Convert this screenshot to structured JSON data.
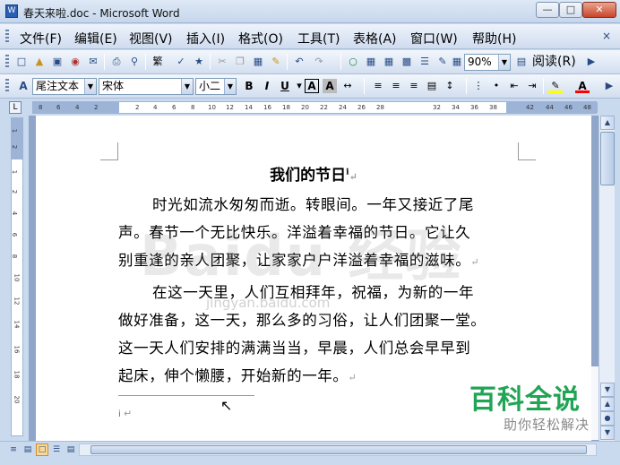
{
  "window": {
    "title": "春天来啦.doc - Microsoft Word",
    "icon": "word-doc-icon"
  },
  "menu": [
    {
      "label": "文件(F)"
    },
    {
      "label": "编辑(E)"
    },
    {
      "label": "视图(V)"
    },
    {
      "label": "插入(I)"
    },
    {
      "label": "格式(O)"
    },
    {
      "label": "工具(T)"
    },
    {
      "label": "表格(A)"
    },
    {
      "label": "窗口(W)"
    },
    {
      "label": "帮助(H)"
    }
  ],
  "toolbar": {
    "zoom": "90%",
    "read_label": "阅读(R)"
  },
  "format_bar": {
    "style": "尾注文本",
    "font": "宋体",
    "size": "小二",
    "bold": "B",
    "italic": "I",
    "underline": "U",
    "char_border": "A",
    "char_shading": "A",
    "highlight_color": "#ffff00",
    "font_color": "#ff0000"
  },
  "ruler": {
    "ticks": [
      "8",
      "6",
      "4",
      "2",
      "",
      "2",
      "4",
      "6",
      "8",
      "10",
      "12",
      "14",
      "16",
      "18",
      "20",
      "22",
      "24",
      "26",
      "28",
      "",
      "32",
      "34",
      "36",
      "38",
      "",
      "42",
      "44",
      "46",
      "48"
    ]
  },
  "vruler": {
    "ticks": [
      "1",
      "2",
      "1",
      "2",
      "4",
      "6",
      "8",
      "10",
      "12",
      "14",
      "16",
      "18",
      "20"
    ]
  },
  "document": {
    "title": "我们的节日",
    "endnote_ref": "i",
    "lines": [
      "时光如流水匆匆而逝。转眼间。一年又接近了尾",
      "声。春节一个无比快乐。洋溢着幸福的节日。它让久",
      "别重逢的亲人团聚，让家家户户洋溢着幸福的滋味。",
      "在这一天里，人们互相拜年，祝福，为新的一年",
      "做好准备，这一天，那么多的习俗，让人们团聚一堂。",
      "这一天人们安排的满满当当，早晨，人们总会早早到",
      "起床，伸个懒腰，开始新的一年。"
    ],
    "endnote_text": "i"
  },
  "watermark": {
    "baidu": "Baidu 经验",
    "site": "jingyan.baidu.com",
    "logo_main": "百科全说",
    "logo_sub": "助你轻松解决"
  }
}
